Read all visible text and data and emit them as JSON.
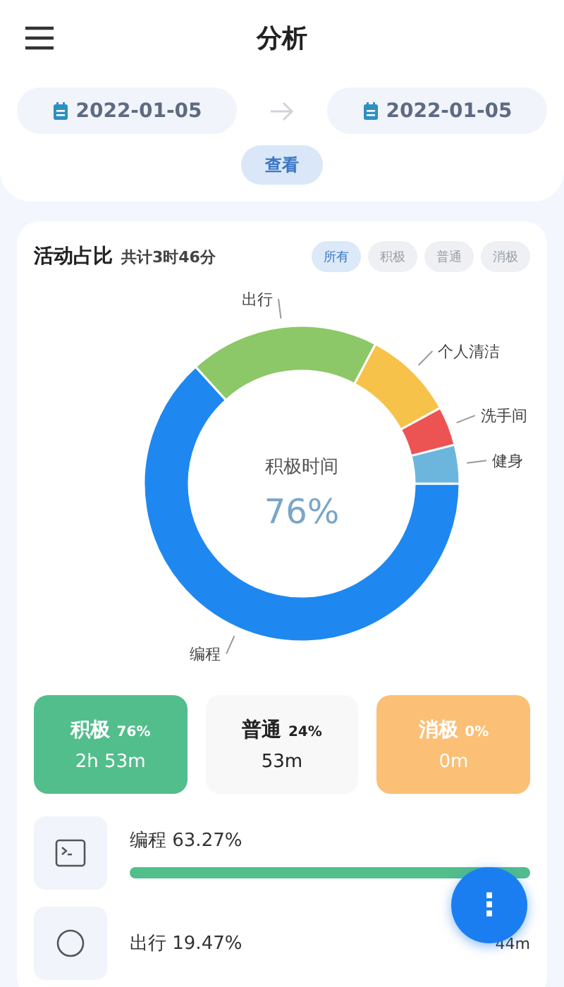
{
  "header": {
    "title": "分析"
  },
  "date_range": {
    "start": "2022-01-05",
    "end": "2022-01-05",
    "button": "查看"
  },
  "activity": {
    "title": "活动占比",
    "total": "共计3时46分",
    "filters": [
      {
        "label": "所有",
        "selected": true
      },
      {
        "label": "积极",
        "selected": false
      },
      {
        "label": "普通",
        "selected": false
      },
      {
        "label": "消极",
        "selected": false
      }
    ],
    "center_label": "积极时间",
    "center_value": "76%",
    "chart_data": {
      "type": "donut",
      "categories": [
        "编程",
        "出行",
        "个人清洁",
        "洗手间",
        "健身"
      ],
      "values": [
        63.27,
        19.47,
        9.3,
        4.0,
        3.96
      ],
      "colors": [
        "#1e88f0",
        "#8cc867",
        "#f7c24a",
        "#ec5454",
        "#6cb6de"
      ]
    }
  },
  "summary": [
    {
      "kind": "positive",
      "label": "积极",
      "percent": "76%",
      "duration": "2h 53m"
    },
    {
      "kind": "neutral",
      "label": "普通",
      "percent": "24%",
      "duration": "53m"
    },
    {
      "kind": "negative",
      "label": "消极",
      "percent": "0%",
      "duration": "0m"
    }
  ],
  "activities": [
    {
      "name": "编程",
      "percent": "63.27%",
      "level": 1
    },
    {
      "name": "出行",
      "percent": "19.47%",
      "time": "44m"
    }
  ],
  "fab": {
    "label": "⋮"
  }
}
